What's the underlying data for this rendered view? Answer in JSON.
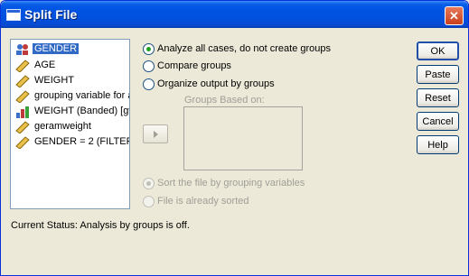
{
  "window": {
    "title": "Split File",
    "close_glyph": "✕"
  },
  "variables": [
    {
      "label": "GENDER",
      "icon": "nominal-variable-icon",
      "selected": true
    },
    {
      "label": "AGE",
      "icon": "scale-variable-icon",
      "selected": false
    },
    {
      "label": "WEIGHT",
      "icon": "scale-variable-icon",
      "selected": false
    },
    {
      "label": "grouping variable for a",
      "icon": "scale-variable-icon",
      "selected": false
    },
    {
      "label": "WEIGHT (Banded) [gv",
      "icon": "ordinal-variable-icon",
      "selected": false
    },
    {
      "label": "geramweight",
      "icon": "scale-variable-icon",
      "selected": false
    },
    {
      "label": "GENDER = 2 (FILTEF",
      "icon": "scale-variable-icon",
      "selected": false
    }
  ],
  "options": {
    "analyze_all": {
      "label": "Analyze all cases, do not create groups",
      "checked": true
    },
    "compare_groups": {
      "label": "Compare groups",
      "checked": false
    },
    "organize_output": {
      "label": "Organize output by groups",
      "checked": false
    }
  },
  "groups_based_on": {
    "label": "Groups Based on:"
  },
  "sort_options": {
    "sort_file": {
      "label": "Sort the file by grouping variables",
      "checked": true,
      "enabled": false
    },
    "already_sorted": {
      "label": "File is already sorted",
      "checked": false,
      "enabled": false
    }
  },
  "buttons": {
    "ok": "OK",
    "paste": "Paste",
    "reset": "Reset",
    "cancel": "Cancel",
    "help": "Help"
  },
  "status": {
    "text": "Current Status:  Analysis by groups is off."
  },
  "colors": {
    "titlebar": "#0054e3",
    "selection": "#316ac5",
    "dialog_bg": "#ece9d8",
    "radio_dot": "#21a121"
  }
}
